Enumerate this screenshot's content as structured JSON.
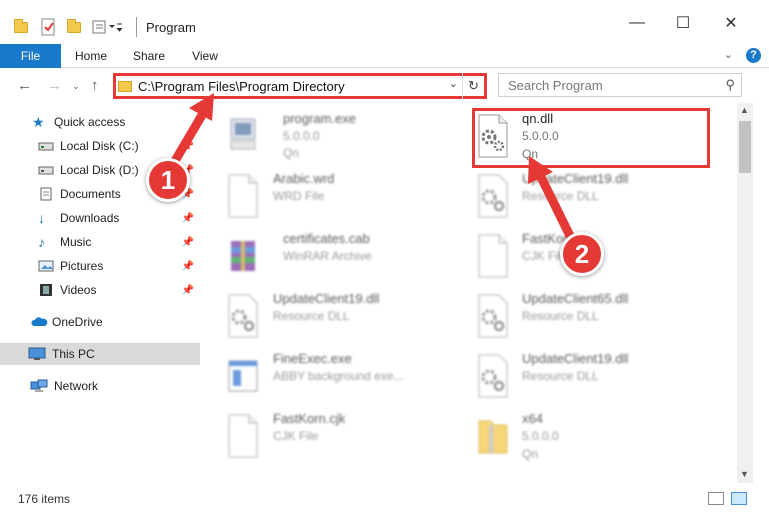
{
  "window": {
    "title": "Program",
    "minimize": "—",
    "maximize": "☐",
    "close": "✕"
  },
  "ribbon": {
    "tabs": [
      "File",
      "Home",
      "Share",
      "View"
    ],
    "help": "?"
  },
  "address": {
    "path": "C:\\Program Files\\Program Directory",
    "search_placeholder": "Search Program"
  },
  "sidebar": {
    "items": [
      {
        "label": "Quick access"
      },
      {
        "label": "Local Disk (C:)"
      },
      {
        "label": "Local Disk (D:)"
      },
      {
        "label": "Documents"
      },
      {
        "label": "Downloads"
      },
      {
        "label": "Music"
      },
      {
        "label": "Pictures"
      },
      {
        "label": "Videos"
      },
      {
        "label": "OneDrive"
      },
      {
        "label": "This PC"
      },
      {
        "label": "Network"
      }
    ]
  },
  "files": [
    {
      "name": "program.exe",
      "line1": "5.0.0.0",
      "line2": "Qn"
    },
    {
      "name": "qn.dll",
      "line1": "5.0.0.0",
      "line2": "Qn"
    },
    {
      "name": "Arabic.wrd",
      "line1": "WRD File",
      "line2": ""
    },
    {
      "name": "UpdateClient19.dll",
      "line1": "Resource DLL",
      "line2": ""
    },
    {
      "name": "certificates.cab",
      "line1": "WinRAR Archive",
      "line2": ""
    },
    {
      "name": "FastKorn",
      "line1": "CJK File",
      "line2": ""
    },
    {
      "name": "UpdateClient19.dll",
      "line1": "Resource DLL",
      "line2": ""
    },
    {
      "name": "UpdateClient65.dll",
      "line1": "Resource DLL",
      "line2": ""
    },
    {
      "name": "FineExec.exe",
      "line1": "ABBY background exe...",
      "line2": ""
    },
    {
      "name": "UpdateClient19.dll",
      "line1": "Resource DLL",
      "line2": ""
    },
    {
      "name": "FastKorn.cjk",
      "line1": "CJK File",
      "line2": ""
    },
    {
      "name": "x64",
      "line1": "5.0.0.0",
      "line2": "Qn"
    }
  ],
  "status": {
    "items_count": "176 items"
  },
  "callouts": {
    "one": "1",
    "two": "2"
  },
  "colors": {
    "accent": "#1979ca",
    "callout": "#e53935",
    "selected": "#d9d9d9"
  }
}
